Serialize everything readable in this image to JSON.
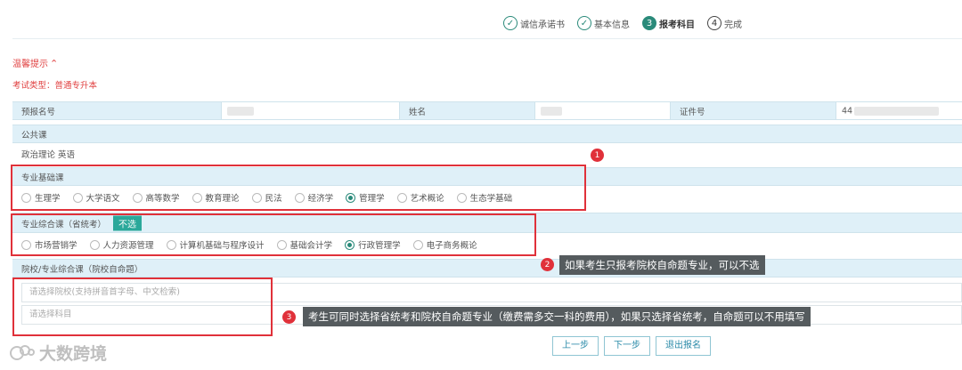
{
  "steps": [
    {
      "num": "✓",
      "label": "诚信承诺书",
      "state": "done"
    },
    {
      "num": "✓",
      "label": "基本信息",
      "state": "done"
    },
    {
      "num": "3",
      "label": "报考科目",
      "state": "current"
    },
    {
      "num": "4",
      "label": "完成",
      "state": "future"
    }
  ],
  "tips_label": "温馨提示",
  "tips_caret": "^",
  "exam_type": "考试类型：普通专升本",
  "id_row": {
    "prereg_label": "预报名号",
    "name_label": "姓名",
    "idcard_label": "证件号",
    "idcard_prefix": "44"
  },
  "public": {
    "header": "公共课",
    "subjects": "政治理论  英语"
  },
  "basic": {
    "header": "专业基础课",
    "options": [
      "生理学",
      "大学语文",
      "高等数学",
      "教育理论",
      "民法",
      "经济学",
      "管理学",
      "艺术概论",
      "生态学基础"
    ],
    "selected": "管理学"
  },
  "comprehensive": {
    "header": "专业综合课（省统考）",
    "none_badge": "不选",
    "options": [
      "市场营销学",
      "人力资源管理",
      "计算机基础与程序设计",
      "基础会计学",
      "行政管理学",
      "电子商务概论"
    ],
    "selected": "行政管理学"
  },
  "school": {
    "header": "院校/专业综合课（院校自命题）",
    "school_placeholder": "请选择院校(支持拼音首字母、中文检索)",
    "subject_placeholder": "请选择科目"
  },
  "annotations": {
    "n1": "1",
    "n2": "2",
    "n3": "3",
    "callout2": "如果考生只报考院校自命题专业，可以不选",
    "callout3": "考生可同时选择省统考和院校自命题专业（缴费需多交一科的费用），如果只选择省统考，自命题可以不用填写"
  },
  "buttons": {
    "prev": "上一步",
    "next": "下一步",
    "exit": "退出报名"
  },
  "watermark": "大数跨境",
  "colors": {
    "accent": "#2a8a7a",
    "red": "#e0313a",
    "row_bg": "#dff0f8"
  }
}
